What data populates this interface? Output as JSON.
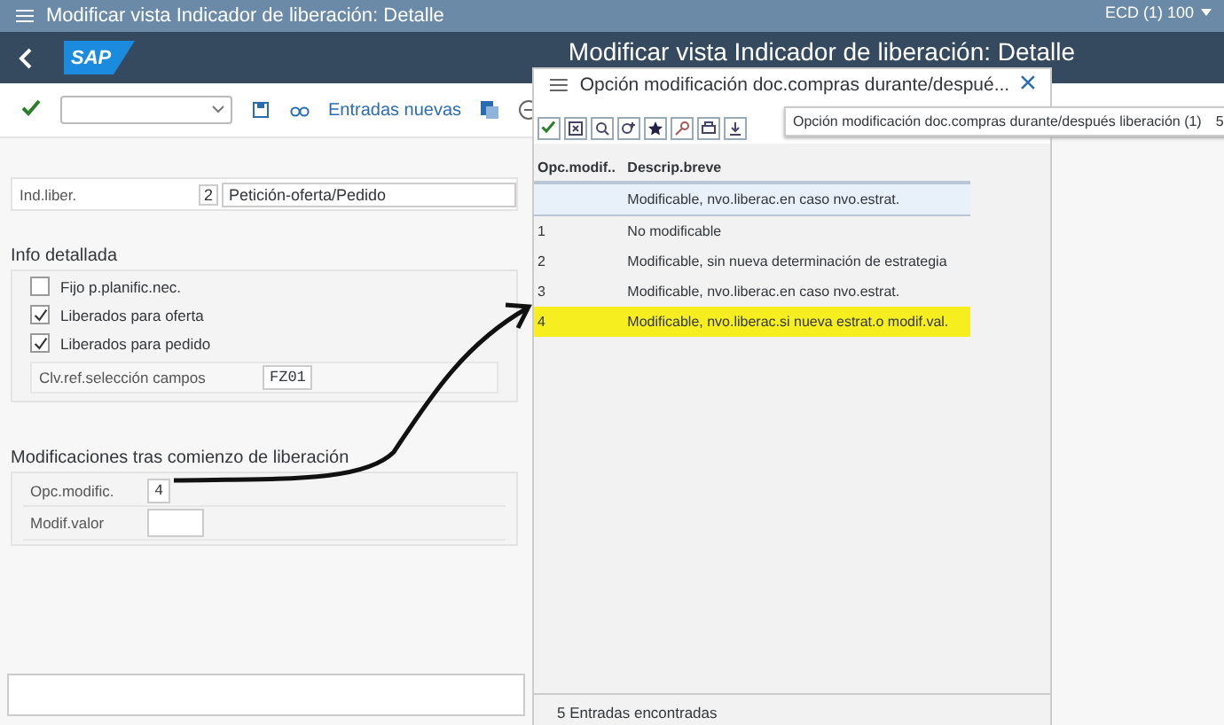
{
  "window": {
    "title": "Modificar vista Indicador de liberación: Detalle"
  },
  "header": {
    "logo": "SAP",
    "title": "Modificar vista Indicador de liberación: Detalle",
    "system": "ECD (1) 100"
  },
  "toolbar": {
    "button": "Entradas nuevas"
  },
  "release_indicator": {
    "label": "Ind.liber.",
    "code": "2",
    "value": "Petición-oferta/Pedido"
  },
  "detail_info": {
    "heading": "Info detallada",
    "checkboxes": [
      {
        "label": "Fijo p.planific.nec.",
        "checked": false
      },
      {
        "label": "Liberados para oferta",
        "checked": true
      },
      {
        "label": "Liberados para pedido",
        "checked": true
      }
    ],
    "field": {
      "label": "Clv.ref.selección campos",
      "value": "FZ01"
    }
  },
  "changes": {
    "heading": "Modificaciones tras comienzo de liberación",
    "fields": [
      {
        "label": "Opc.modific.",
        "value": "4"
      },
      {
        "label": "Modif.valor"
      }
    ]
  },
  "dialog": {
    "title": "Opción modificación doc.compras durante/despué...",
    "columns": [
      "Opc.modif..",
      "Descrip.breve"
    ],
    "rows": [
      {
        "option": "",
        "description": "Modificable, nvo.liberac.en caso nvo.estrat.",
        "selected": true,
        "highlighted": false
      },
      {
        "option": "1",
        "description": "No modificable",
        "selected": false,
        "highlighted": false
      },
      {
        "option": "2",
        "description": "Modificable, sin nueva determinación de estrategia",
        "selected": false,
        "highlighted": false
      },
      {
        "option": "3",
        "description": "Modificable, nvo.liberac.en caso nvo.estrat.",
        "selected": false,
        "highlighted": false
      },
      {
        "option": "4",
        "description": "Modificable, nvo.liberac.si nueva estrat.o modif.val.",
        "selected": false,
        "highlighted": true
      }
    ],
    "status": "5 Entradas encontradas"
  },
  "tooltip": {
    "text": "Opción modificación doc.compras durante/después liberación (1)",
    "overflow": "5"
  }
}
